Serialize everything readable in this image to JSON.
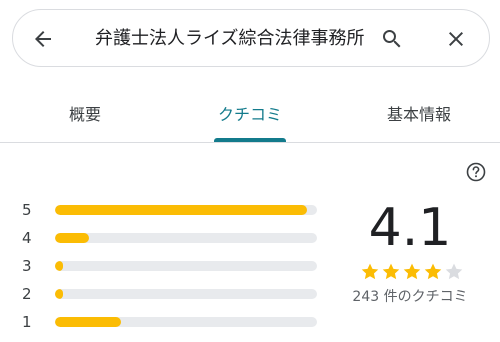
{
  "search": {
    "query": "弁護士法人ライズ綜合法律事務所",
    "back_icon": "arrow-back-icon",
    "search_icon": "search-icon",
    "close_icon": "close-icon"
  },
  "tabs": [
    {
      "label": "概要",
      "active": false
    },
    {
      "label": "クチコミ",
      "active": true
    },
    {
      "label": "基本情報",
      "active": false
    }
  ],
  "colors": {
    "accent": "#137b8c",
    "star": "#fbbc04",
    "star_empty": "#dadce0"
  },
  "rating": {
    "score": "4.1",
    "stars": 4,
    "count_text": "243 件のクチコミ",
    "help_icon": "help-circle-icon",
    "histogram": [
      {
        "label": "5",
        "fraction": 0.96
      },
      {
        "label": "4",
        "fraction": 0.13
      },
      {
        "label": "3",
        "fraction": 0.03
      },
      {
        "label": "2",
        "fraction": 0.03
      },
      {
        "label": "1",
        "fraction": 0.25
      }
    ]
  }
}
